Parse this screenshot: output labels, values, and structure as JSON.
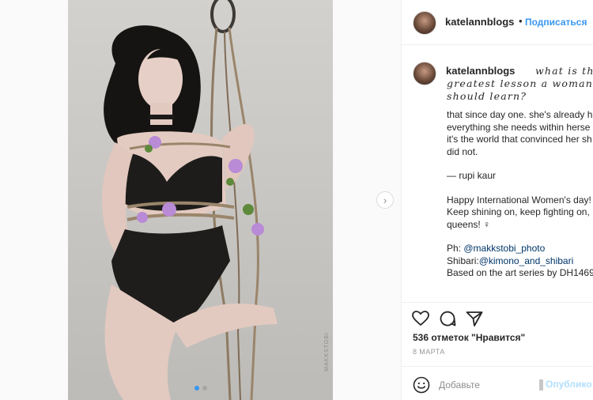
{
  "post": {
    "username": "katelannblogs",
    "separator": "•",
    "follow_label": "Подписаться",
    "watermark": "MAKKSTOBI",
    "caption": {
      "username": "katelannblogs",
      "fancy_line1": "what is the",
      "fancy_line2": "greatest lesson a woman",
      "fancy_line3": "should learn?",
      "lines": [
        "that since day one. she's already h",
        "everything she needs within herse",
        "it's the world that convinced her sh",
        "did not."
      ],
      "attribution": "— rupi kaur",
      "greeting": [
        "Happy International Women's day!",
        "Keep shining on, keep fighting on,",
        "queens! ♀"
      ],
      "credits": {
        "ph_prefix": "Ph: ",
        "ph_handle": "@makkstobi_photo",
        "shibari_prefix": "Shibari:",
        "shibari_handle": "@kimono_and_shibari",
        "series": "Based on the art series by DH1469"
      }
    },
    "likes_text": "536 отметок \"Нравится\"",
    "date": "8 МАРТА",
    "comment_placeholder": "Добавьте",
    "publish_label": "Опублико",
    "carousel": {
      "count": 2,
      "active_index": 0
    }
  },
  "icons": {
    "like": "heart-icon",
    "comment": "comment-icon",
    "share": "share-icon",
    "emoji": "emoji-icon",
    "next": "chevron-right-icon"
  },
  "colors": {
    "link": "#003569",
    "follow": "#3897f0",
    "publish": "#b2dffc"
  }
}
